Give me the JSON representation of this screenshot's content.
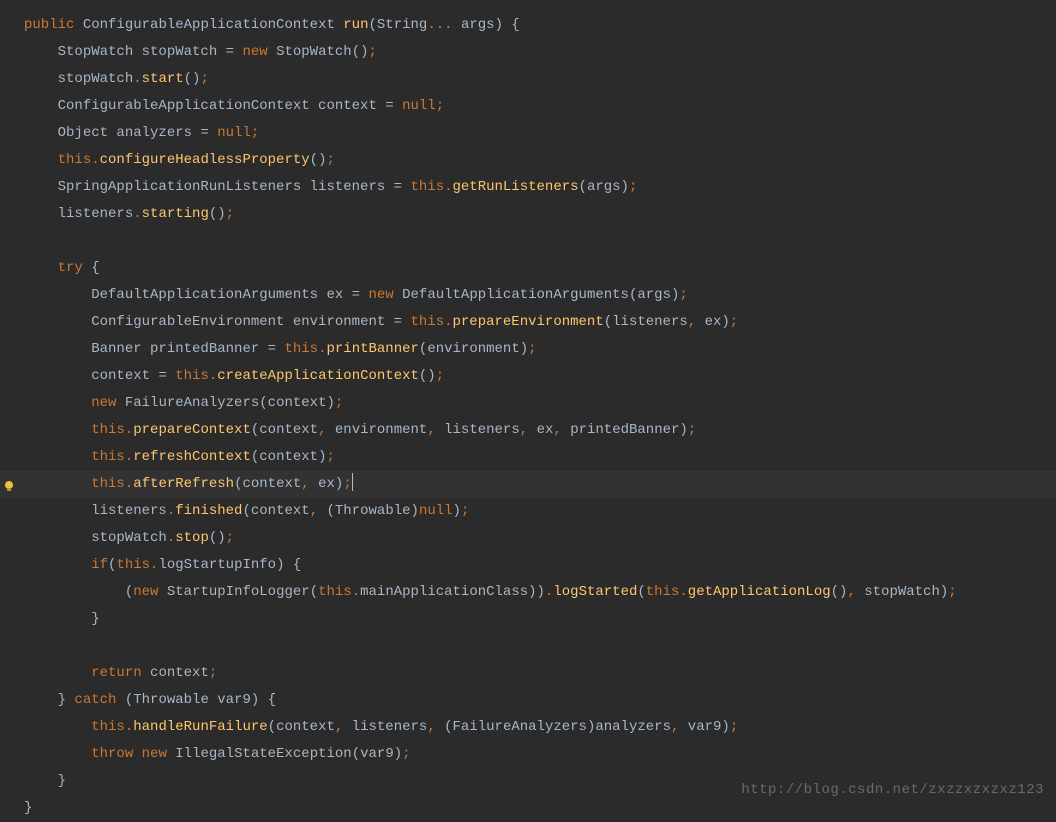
{
  "code": {
    "lines": [
      {
        "indent": 0,
        "tokens": [
          {
            "t": "keyword",
            "v": "public"
          },
          {
            "t": "ws",
            "v": " "
          },
          {
            "t": "type",
            "v": "ConfigurableApplicationContext "
          },
          {
            "t": "method",
            "v": "run"
          },
          {
            "t": "paren",
            "v": "("
          },
          {
            "t": "type",
            "v": "String"
          },
          {
            "t": "punct",
            "v": "..."
          },
          {
            "t": "ws",
            "v": " "
          },
          {
            "t": "ident",
            "v": "args"
          },
          {
            "t": "paren",
            "v": ")"
          },
          {
            "t": "ws",
            "v": " "
          },
          {
            "t": "paren",
            "v": "{"
          }
        ]
      },
      {
        "indent": 1,
        "tokens": [
          {
            "t": "type",
            "v": "StopWatch stopWatch "
          },
          {
            "t": "ident",
            "v": "= "
          },
          {
            "t": "keyword",
            "v": "new"
          },
          {
            "t": "ws",
            "v": " "
          },
          {
            "t": "type",
            "v": "StopWatch"
          },
          {
            "t": "paren",
            "v": "()"
          },
          {
            "t": "semi",
            "v": ";"
          }
        ]
      },
      {
        "indent": 1,
        "tokens": [
          {
            "t": "ident",
            "v": "stopWatch"
          },
          {
            "t": "punct",
            "v": "."
          },
          {
            "t": "method",
            "v": "start"
          },
          {
            "t": "paren",
            "v": "()"
          },
          {
            "t": "semi",
            "v": ";"
          }
        ]
      },
      {
        "indent": 1,
        "tokens": [
          {
            "t": "type",
            "v": "ConfigurableApplicationContext context "
          },
          {
            "t": "ident",
            "v": "= "
          },
          {
            "t": "keyword",
            "v": "null"
          },
          {
            "t": "semi",
            "v": ";"
          }
        ]
      },
      {
        "indent": 1,
        "tokens": [
          {
            "t": "type",
            "v": "Object analyzers "
          },
          {
            "t": "ident",
            "v": "= "
          },
          {
            "t": "keyword",
            "v": "null"
          },
          {
            "t": "semi",
            "v": ";"
          }
        ]
      },
      {
        "indent": 1,
        "tokens": [
          {
            "t": "keyword",
            "v": "this"
          },
          {
            "t": "punct",
            "v": "."
          },
          {
            "t": "method",
            "v": "configureHeadlessProperty"
          },
          {
            "t": "paren",
            "v": "()"
          },
          {
            "t": "semi",
            "v": ";"
          }
        ]
      },
      {
        "indent": 1,
        "tokens": [
          {
            "t": "type",
            "v": "SpringApplicationRunListeners listeners "
          },
          {
            "t": "ident",
            "v": "= "
          },
          {
            "t": "keyword",
            "v": "this"
          },
          {
            "t": "punct",
            "v": "."
          },
          {
            "t": "method",
            "v": "getRunListeners"
          },
          {
            "t": "paren",
            "v": "("
          },
          {
            "t": "ident",
            "v": "args"
          },
          {
            "t": "paren",
            "v": ")"
          },
          {
            "t": "semi",
            "v": ";"
          }
        ]
      },
      {
        "indent": 1,
        "tokens": [
          {
            "t": "ident",
            "v": "listeners"
          },
          {
            "t": "punct",
            "v": "."
          },
          {
            "t": "method",
            "v": "starting"
          },
          {
            "t": "paren",
            "v": "()"
          },
          {
            "t": "semi",
            "v": ";"
          }
        ]
      },
      {
        "indent": 0,
        "tokens": []
      },
      {
        "indent": 1,
        "tokens": [
          {
            "t": "keyword",
            "v": "try"
          },
          {
            "t": "ws",
            "v": " "
          },
          {
            "t": "paren",
            "v": "{"
          }
        ]
      },
      {
        "indent": 2,
        "tokens": [
          {
            "t": "type",
            "v": "DefaultApplicationArguments ex "
          },
          {
            "t": "ident",
            "v": "= "
          },
          {
            "t": "keyword",
            "v": "new"
          },
          {
            "t": "ws",
            "v": " "
          },
          {
            "t": "type",
            "v": "DefaultApplicationArguments"
          },
          {
            "t": "paren",
            "v": "("
          },
          {
            "t": "ident",
            "v": "args"
          },
          {
            "t": "paren",
            "v": ")"
          },
          {
            "t": "semi",
            "v": ";"
          }
        ]
      },
      {
        "indent": 2,
        "tokens": [
          {
            "t": "type",
            "v": "ConfigurableEnvironment environment "
          },
          {
            "t": "ident",
            "v": "= "
          },
          {
            "t": "keyword",
            "v": "this"
          },
          {
            "t": "punct",
            "v": "."
          },
          {
            "t": "method",
            "v": "prepareEnvironment"
          },
          {
            "t": "paren",
            "v": "("
          },
          {
            "t": "ident",
            "v": "listeners"
          },
          {
            "t": "punct",
            "v": ","
          },
          {
            "t": "ws",
            "v": " "
          },
          {
            "t": "ident",
            "v": "ex"
          },
          {
            "t": "paren",
            "v": ")"
          },
          {
            "t": "semi",
            "v": ";"
          }
        ]
      },
      {
        "indent": 2,
        "tokens": [
          {
            "t": "type",
            "v": "Banner printedBanner "
          },
          {
            "t": "ident",
            "v": "= "
          },
          {
            "t": "keyword",
            "v": "this"
          },
          {
            "t": "punct",
            "v": "."
          },
          {
            "t": "method",
            "v": "printBanner"
          },
          {
            "t": "paren",
            "v": "("
          },
          {
            "t": "ident",
            "v": "environment"
          },
          {
            "t": "paren",
            "v": ")"
          },
          {
            "t": "semi",
            "v": ";"
          }
        ]
      },
      {
        "indent": 2,
        "tokens": [
          {
            "t": "ident",
            "v": "context "
          },
          {
            "t": "ident",
            "v": "= "
          },
          {
            "t": "keyword",
            "v": "this"
          },
          {
            "t": "punct",
            "v": "."
          },
          {
            "t": "method",
            "v": "createApplicationContext"
          },
          {
            "t": "paren",
            "v": "()"
          },
          {
            "t": "semi",
            "v": ";"
          }
        ]
      },
      {
        "indent": 2,
        "tokens": [
          {
            "t": "keyword",
            "v": "new"
          },
          {
            "t": "ws",
            "v": " "
          },
          {
            "t": "type",
            "v": "FailureAnalyzers"
          },
          {
            "t": "paren",
            "v": "("
          },
          {
            "t": "ident",
            "v": "context"
          },
          {
            "t": "paren",
            "v": ")"
          },
          {
            "t": "semi",
            "v": ";"
          }
        ]
      },
      {
        "indent": 2,
        "tokens": [
          {
            "t": "keyword",
            "v": "this"
          },
          {
            "t": "punct",
            "v": "."
          },
          {
            "t": "method",
            "v": "prepareContext"
          },
          {
            "t": "paren",
            "v": "("
          },
          {
            "t": "ident",
            "v": "context"
          },
          {
            "t": "punct",
            "v": ","
          },
          {
            "t": "ws",
            "v": " "
          },
          {
            "t": "ident",
            "v": "environment"
          },
          {
            "t": "punct",
            "v": ","
          },
          {
            "t": "ws",
            "v": " "
          },
          {
            "t": "ident",
            "v": "listeners"
          },
          {
            "t": "punct",
            "v": ","
          },
          {
            "t": "ws",
            "v": " "
          },
          {
            "t": "ident",
            "v": "ex"
          },
          {
            "t": "punct",
            "v": ","
          },
          {
            "t": "ws",
            "v": " "
          },
          {
            "t": "ident",
            "v": "printedBanner"
          },
          {
            "t": "paren",
            "v": ")"
          },
          {
            "t": "semi",
            "v": ";"
          }
        ]
      },
      {
        "indent": 2,
        "tokens": [
          {
            "t": "keyword",
            "v": "this"
          },
          {
            "t": "punct",
            "v": "."
          },
          {
            "t": "method",
            "v": "refreshContext"
          },
          {
            "t": "paren",
            "v": "("
          },
          {
            "t": "ident",
            "v": "context"
          },
          {
            "t": "paren",
            "v": ")"
          },
          {
            "t": "semi",
            "v": ";"
          }
        ]
      },
      {
        "indent": 2,
        "highlighted": true,
        "bulb": true,
        "tokens": [
          {
            "t": "keyword",
            "v": "this"
          },
          {
            "t": "punct",
            "v": "."
          },
          {
            "t": "method",
            "v": "afterRefresh"
          },
          {
            "t": "paren",
            "v": "("
          },
          {
            "t": "ident",
            "v": "context"
          },
          {
            "t": "punct",
            "v": ","
          },
          {
            "t": "ws",
            "v": " "
          },
          {
            "t": "ident",
            "v": "ex"
          },
          {
            "t": "paren",
            "v": ")"
          },
          {
            "t": "semi",
            "v": ";"
          },
          {
            "t": "cursor",
            "v": ""
          }
        ]
      },
      {
        "indent": 2,
        "tokens": [
          {
            "t": "ident",
            "v": "listeners"
          },
          {
            "t": "punct",
            "v": "."
          },
          {
            "t": "method",
            "v": "finished"
          },
          {
            "t": "paren",
            "v": "("
          },
          {
            "t": "ident",
            "v": "context"
          },
          {
            "t": "punct",
            "v": ","
          },
          {
            "t": "ws",
            "v": " "
          },
          {
            "t": "paren",
            "v": "("
          },
          {
            "t": "type",
            "v": "Throwable"
          },
          {
            "t": "paren",
            "v": ")"
          },
          {
            "t": "keyword",
            "v": "null"
          },
          {
            "t": "paren",
            "v": ")"
          },
          {
            "t": "semi",
            "v": ";"
          }
        ]
      },
      {
        "indent": 2,
        "tokens": [
          {
            "t": "ident",
            "v": "stopWatch"
          },
          {
            "t": "punct",
            "v": "."
          },
          {
            "t": "method",
            "v": "stop"
          },
          {
            "t": "paren",
            "v": "()"
          },
          {
            "t": "semi",
            "v": ";"
          }
        ]
      },
      {
        "indent": 2,
        "tokens": [
          {
            "t": "keyword",
            "v": "if"
          },
          {
            "t": "paren",
            "v": "("
          },
          {
            "t": "keyword",
            "v": "this"
          },
          {
            "t": "punct",
            "v": "."
          },
          {
            "t": "ident",
            "v": "logStartupInfo"
          },
          {
            "t": "paren",
            "v": ")"
          },
          {
            "t": "ws",
            "v": " "
          },
          {
            "t": "paren",
            "v": "{"
          }
        ]
      },
      {
        "indent": 3,
        "tokens": [
          {
            "t": "paren",
            "v": "("
          },
          {
            "t": "keyword",
            "v": "new"
          },
          {
            "t": "ws",
            "v": " "
          },
          {
            "t": "type",
            "v": "StartupInfoLogger"
          },
          {
            "t": "paren",
            "v": "("
          },
          {
            "t": "keyword",
            "v": "this"
          },
          {
            "t": "punct",
            "v": "."
          },
          {
            "t": "ident",
            "v": "mainApplicationClass"
          },
          {
            "t": "paren",
            "v": "))"
          },
          {
            "t": "punct",
            "v": "."
          },
          {
            "t": "method",
            "v": "logStarted"
          },
          {
            "t": "paren",
            "v": "("
          },
          {
            "t": "keyword",
            "v": "this"
          },
          {
            "t": "punct",
            "v": "."
          },
          {
            "t": "method",
            "v": "getApplicationLog"
          },
          {
            "t": "paren",
            "v": "()"
          },
          {
            "t": "punct",
            "v": ","
          },
          {
            "t": "ws",
            "v": " "
          },
          {
            "t": "ident",
            "v": "stopWatch"
          },
          {
            "t": "paren",
            "v": ")"
          },
          {
            "t": "semi",
            "v": ";"
          }
        ]
      },
      {
        "indent": 2,
        "tokens": [
          {
            "t": "paren",
            "v": "}"
          }
        ]
      },
      {
        "indent": 0,
        "tokens": []
      },
      {
        "indent": 2,
        "tokens": [
          {
            "t": "keyword",
            "v": "return"
          },
          {
            "t": "ws",
            "v": " "
          },
          {
            "t": "ident",
            "v": "context"
          },
          {
            "t": "semi",
            "v": ";"
          }
        ]
      },
      {
        "indent": 1,
        "tokens": [
          {
            "t": "paren",
            "v": "}"
          },
          {
            "t": "ws",
            "v": " "
          },
          {
            "t": "keyword",
            "v": "catch"
          },
          {
            "t": "ws",
            "v": " "
          },
          {
            "t": "paren",
            "v": "("
          },
          {
            "t": "type",
            "v": "Throwable var9"
          },
          {
            "t": "paren",
            "v": ")"
          },
          {
            "t": "ws",
            "v": " "
          },
          {
            "t": "paren",
            "v": "{"
          }
        ]
      },
      {
        "indent": 2,
        "tokens": [
          {
            "t": "keyword",
            "v": "this"
          },
          {
            "t": "punct",
            "v": "."
          },
          {
            "t": "method",
            "v": "handleRunFailure"
          },
          {
            "t": "paren",
            "v": "("
          },
          {
            "t": "ident",
            "v": "context"
          },
          {
            "t": "punct",
            "v": ","
          },
          {
            "t": "ws",
            "v": " "
          },
          {
            "t": "ident",
            "v": "listeners"
          },
          {
            "t": "punct",
            "v": ","
          },
          {
            "t": "ws",
            "v": " "
          },
          {
            "t": "paren",
            "v": "("
          },
          {
            "t": "type",
            "v": "FailureAnalyzers"
          },
          {
            "t": "paren",
            "v": ")"
          },
          {
            "t": "ident",
            "v": "analyzers"
          },
          {
            "t": "punct",
            "v": ","
          },
          {
            "t": "ws",
            "v": " "
          },
          {
            "t": "ident",
            "v": "var9"
          },
          {
            "t": "paren",
            "v": ")"
          },
          {
            "t": "semi",
            "v": ";"
          }
        ]
      },
      {
        "indent": 2,
        "tokens": [
          {
            "t": "keyword",
            "v": "throw"
          },
          {
            "t": "ws",
            "v": " "
          },
          {
            "t": "keyword",
            "v": "new"
          },
          {
            "t": "ws",
            "v": " "
          },
          {
            "t": "type",
            "v": "IllegalStateException"
          },
          {
            "t": "paren",
            "v": "("
          },
          {
            "t": "ident",
            "v": "var9"
          },
          {
            "t": "paren",
            "v": ")"
          },
          {
            "t": "semi",
            "v": ";"
          }
        ]
      },
      {
        "indent": 1,
        "tokens": [
          {
            "t": "paren",
            "v": "}"
          }
        ]
      },
      {
        "indent": 0,
        "tokens": [
          {
            "t": "paren",
            "v": "}"
          }
        ]
      }
    ]
  },
  "watermark": "http://blog.csdn.net/zxzzxzxzxz123",
  "colors": {
    "background": "#2b2b2b",
    "highlight": "#323232",
    "keyword": "#cc7832",
    "method": "#ffc66d",
    "default": "#a9b7c6"
  }
}
